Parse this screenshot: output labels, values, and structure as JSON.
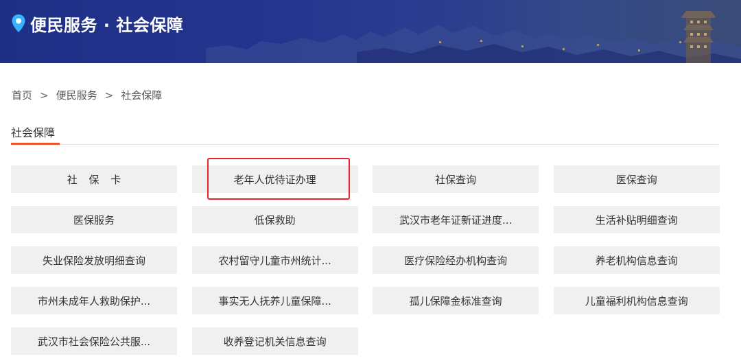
{
  "banner": {
    "title": "便民服务 · 社会保障",
    "icon": "location-pin-icon"
  },
  "breadcrumb": {
    "items": [
      "首页",
      "便民服务",
      "社会保障"
    ],
    "separator": ">"
  },
  "section": {
    "title": "社会保障",
    "accent_color": "#e8552e"
  },
  "services": [
    "社 保 卡",
    "老年人优待证办理",
    "社保查询",
    "医保查询",
    "医保服务",
    "低保救助",
    "武汉市老年证新证进度...",
    "生活补贴明细查询",
    "失业保险发放明细查询",
    "农村留守儿童市州统计...",
    "医疗保险经办机构查询",
    "养老机构信息查询",
    "市州未成年人救助保护...",
    "事实无人抚养儿童保障...",
    "孤儿保障金标准查询",
    "儿童福利机构信息查询",
    "武汉市社会保险公共服...",
    "收养登记机关信息查询"
  ],
  "highlight": {
    "color": "#e8242a"
  }
}
